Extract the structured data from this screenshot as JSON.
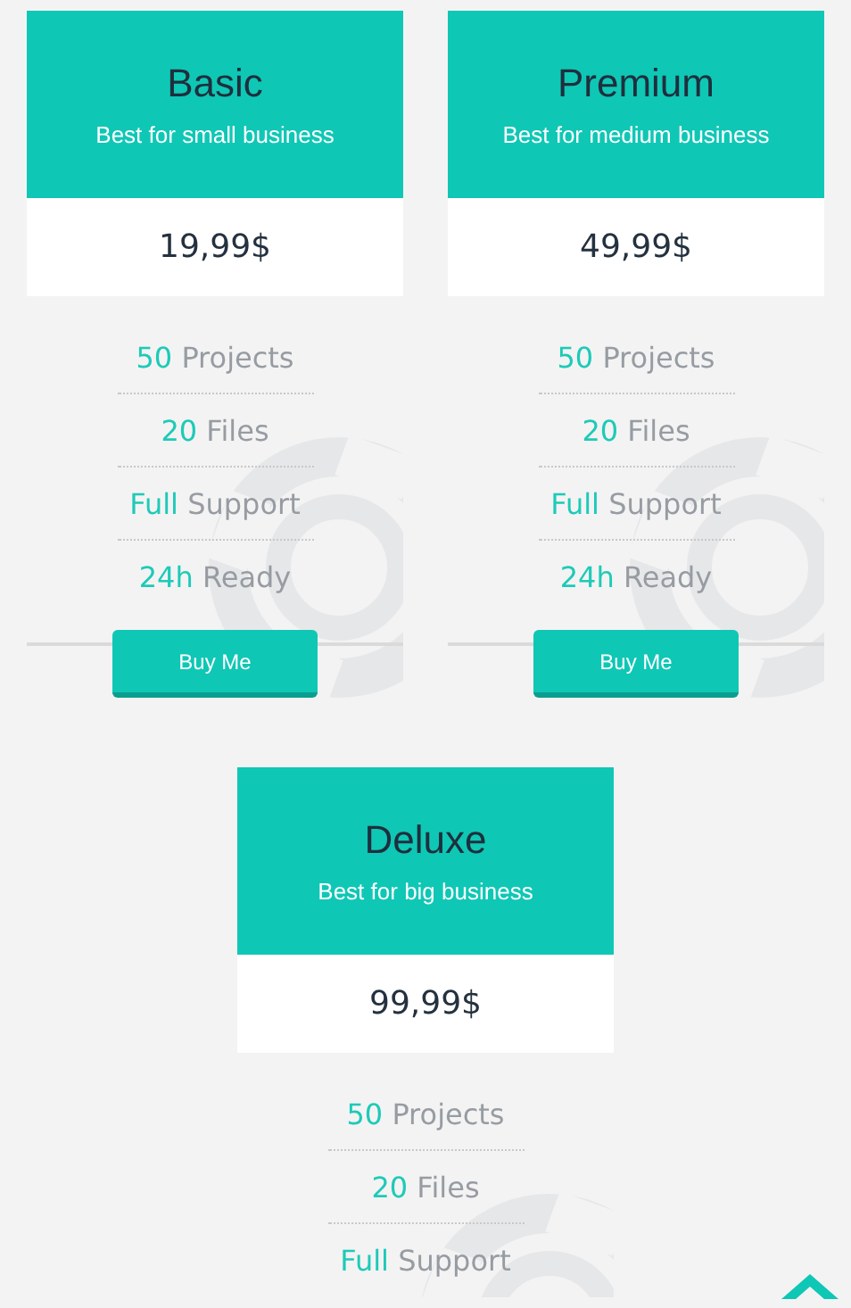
{
  "plans": [
    {
      "name": "Basic",
      "subtitle": "Best for small business",
      "price": "19,99$",
      "features": [
        {
          "value": "50",
          "label": "Projects"
        },
        {
          "value": "20",
          "label": "Files"
        },
        {
          "value": "Full",
          "label": "Support"
        },
        {
          "value": "24h",
          "label": "Ready"
        }
      ],
      "button": "Buy Me"
    },
    {
      "name": "Premium",
      "subtitle": "Best for medium business",
      "price": "49,99$",
      "features": [
        {
          "value": "50",
          "label": "Projects"
        },
        {
          "value": "20",
          "label": "Files"
        },
        {
          "value": "Full",
          "label": "Support"
        },
        {
          "value": "24h",
          "label": "Ready"
        }
      ],
      "button": "Buy Me"
    },
    {
      "name": "Deluxe",
      "subtitle": "Best for big business",
      "price": "99,99$",
      "features": [
        {
          "value": "50",
          "label": "Projects"
        },
        {
          "value": "20",
          "label": "Files"
        },
        {
          "value": "Full",
          "label": "Support"
        }
      ]
    }
  ]
}
